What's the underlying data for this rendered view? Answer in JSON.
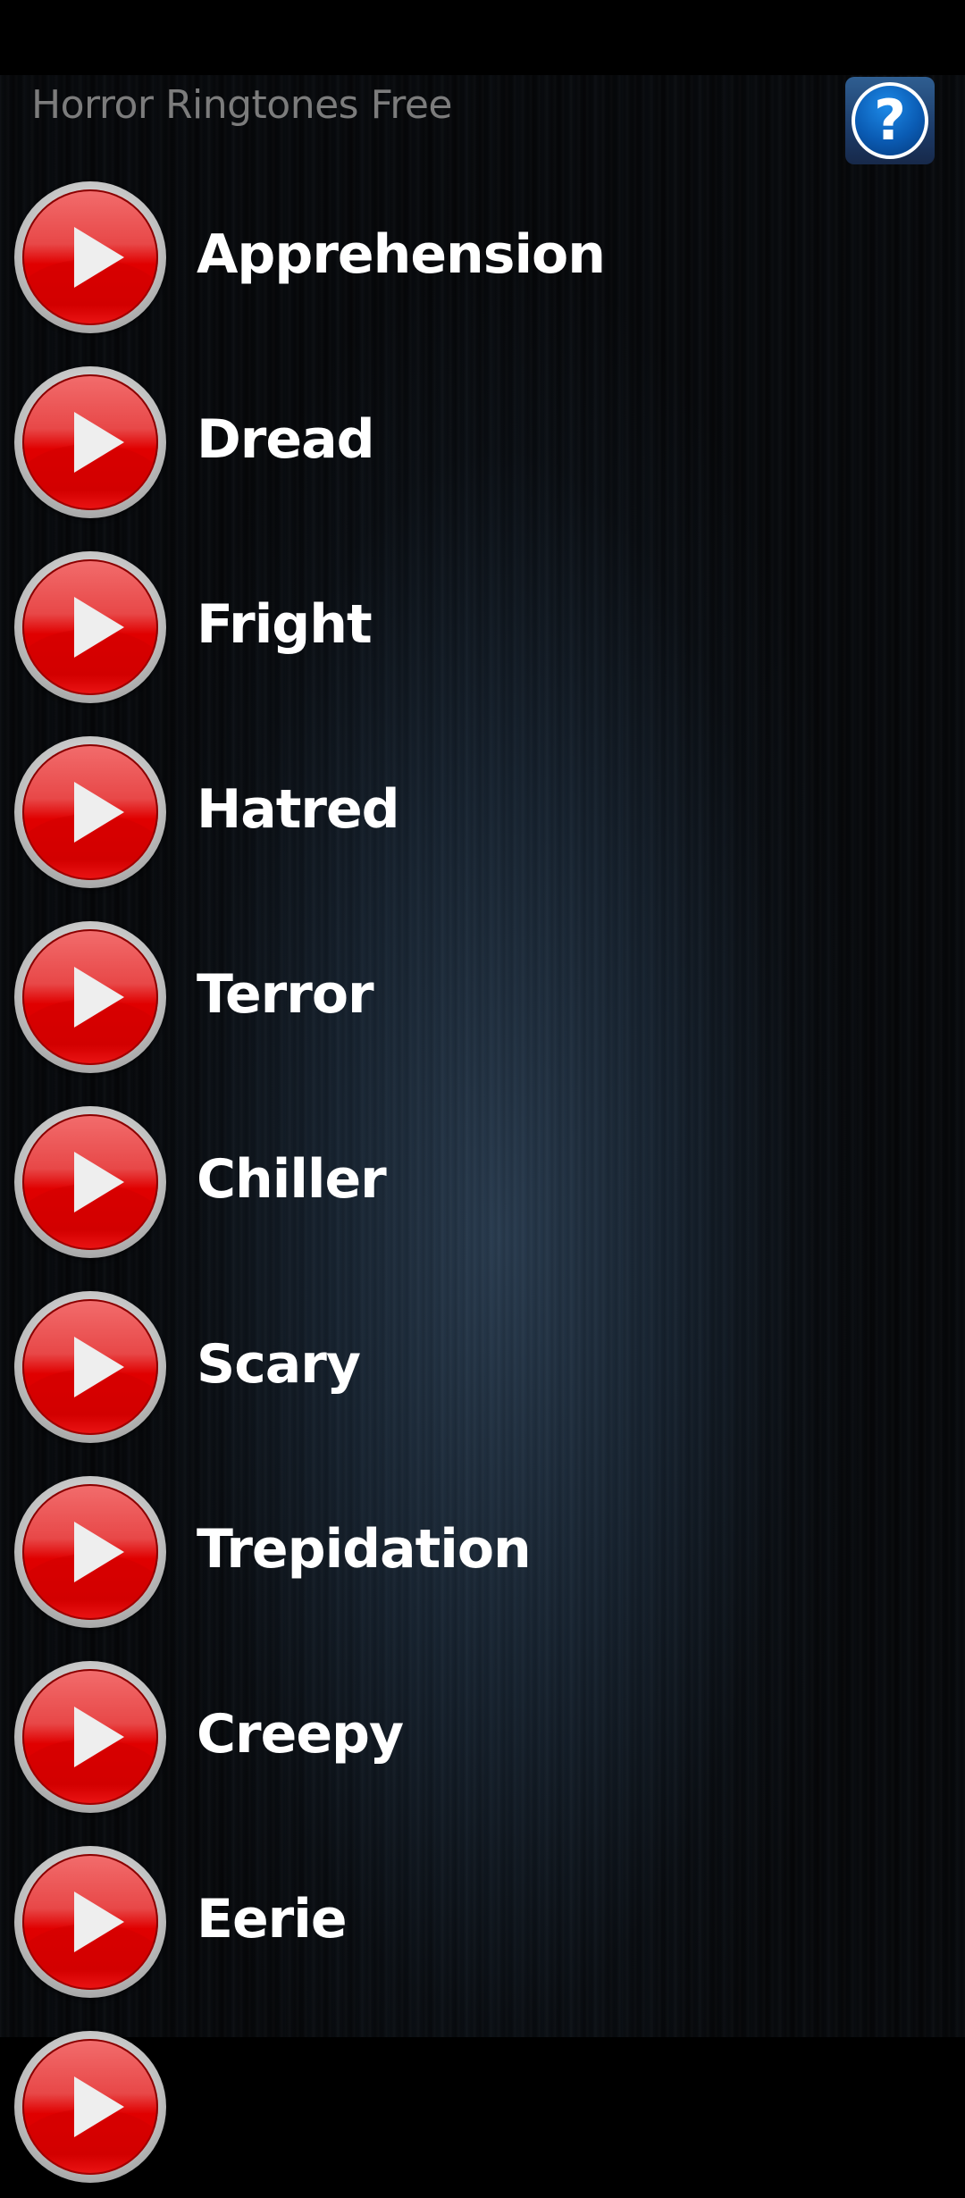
{
  "app": {
    "title": "Horror Ringtones Free",
    "help_icon": "question-mark-icon",
    "colors": {
      "title_text": "#7c7c7c",
      "play_button": "#e00000",
      "help_button": "#0a5bb3"
    }
  },
  "ringtones": [
    {
      "label": "Apprehension",
      "icon": "play-icon"
    },
    {
      "label": "Dread",
      "icon": "play-icon"
    },
    {
      "label": "Fright",
      "icon": "play-icon"
    },
    {
      "label": "Hatred",
      "icon": "play-icon"
    },
    {
      "label": "Terror",
      "icon": "play-icon"
    },
    {
      "label": "Chiller",
      "icon": "play-icon"
    },
    {
      "label": "Scary",
      "icon": "play-icon"
    },
    {
      "label": "Trepidation",
      "icon": "play-icon"
    },
    {
      "label": "Creepy",
      "icon": "play-icon"
    },
    {
      "label": "Eerie",
      "icon": "play-icon"
    },
    {
      "label": "",
      "icon": "play-icon"
    }
  ]
}
